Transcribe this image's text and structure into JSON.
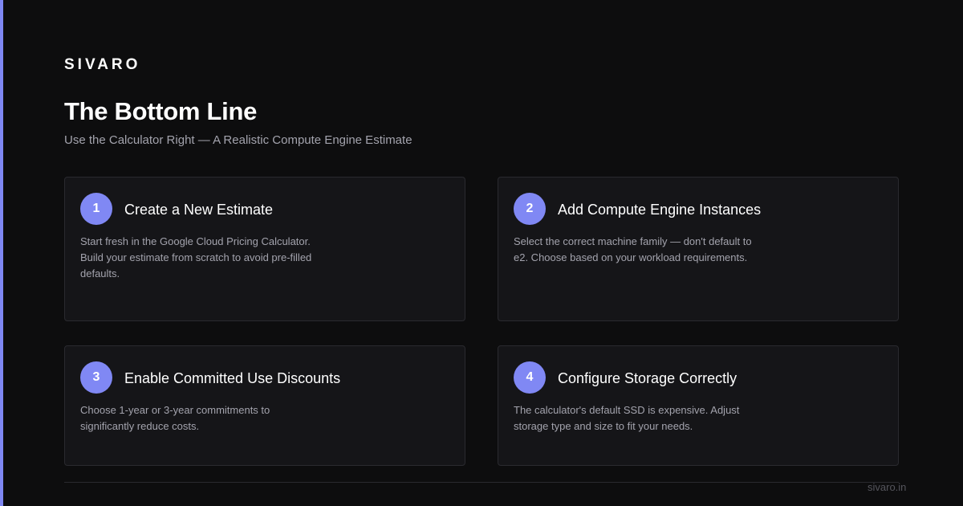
{
  "brand": "SIVARO",
  "title": "The Bottom Line",
  "subtitle": "Use the Calculator Right — A Realistic Compute Engine Estimate",
  "colors": {
    "accent": "#7f87f2",
    "badge": "#8088f4",
    "background": "#0d0d0e",
    "card_background": "#151518"
  },
  "steps": [
    {
      "number": "1",
      "title": "Create a New Estimate",
      "description": "Start fresh in the Google Cloud Pricing Calculator. Build your estimate from scratch to avoid pre-filled defaults."
    },
    {
      "number": "2",
      "title": "Add Compute Engine Instances",
      "description": "Select the correct machine family — don't default to e2. Choose based on your workload requirements."
    },
    {
      "number": "3",
      "title": "Enable Committed Use Discounts",
      "description": "Choose 1-year or 3-year commitments to significantly reduce costs."
    },
    {
      "number": "4",
      "title": "Configure Storage Correctly",
      "description": "The calculator's default SSD is expensive. Adjust storage type and size to fit your needs."
    }
  ],
  "footer": {
    "url": "sivaro.in"
  }
}
